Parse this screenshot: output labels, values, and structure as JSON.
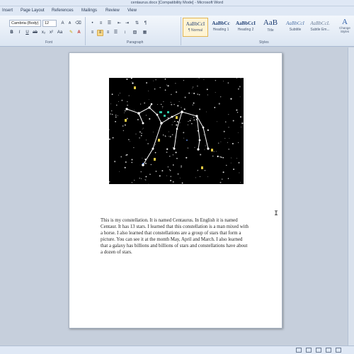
{
  "window": {
    "title": "centaurus.docx [Compatibility Mode] - Microsoft Word"
  },
  "menu_tabs": [
    {
      "label": "Insert"
    },
    {
      "label": "Page Layout"
    },
    {
      "label": "References"
    },
    {
      "label": "Mailings"
    },
    {
      "label": "Review"
    },
    {
      "label": "View"
    }
  ],
  "ribbon": {
    "font_name": "Cambria (Body)",
    "font_size": "12",
    "group_labels": {
      "font": "Font",
      "paragraph": "Paragraph",
      "styles": "Styles"
    },
    "styles": [
      {
        "sample": "AaBbCcI",
        "caption": "¶ Normal",
        "active": true
      },
      {
        "sample": "AaBbCc",
        "caption": "Heading 1",
        "active": false
      },
      {
        "sample": "AaBbCcI",
        "caption": "Heading 2",
        "active": false
      },
      {
        "sample": "AaB",
        "caption": "Title",
        "active": false
      },
      {
        "sample": "AaBbCcI",
        "caption": "Subtitle",
        "active": false
      },
      {
        "sample": "AaBbCcL",
        "caption": "Subtle Em...",
        "active": false
      }
    ],
    "change_styles_label": "Change Styles"
  },
  "document": {
    "body_text": "This is my constellation. It is named Centaurus. In English it is named Centaur. It has 13 stars. I learned that this constellation is a man mixed with a horse. I also learned that constellations are a group of stars that form a picture. You can see it at the month May, April and March. I also learned that a galaxy has billions and billions of stars and constellations have about a dozen of stars."
  },
  "colors": {
    "image_background": "#000000",
    "constellation_lines": "#ffffff",
    "star_marker": "#dfc742",
    "label_text": "#2ec4a2"
  },
  "icons": {
    "text_cursor": "I"
  }
}
